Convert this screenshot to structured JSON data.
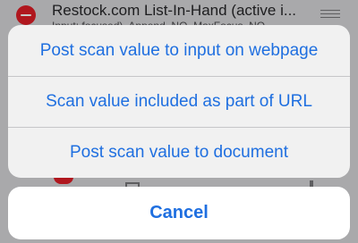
{
  "background_row": {
    "title": "Restock.com List-In-Hand (active i...",
    "subtitle": "Input: focused), Append, NO, MaxFocus, NO",
    "icon": "minus-circle-icon"
  },
  "action_sheet": {
    "options": [
      {
        "label": "Post scan value to input on webpage"
      },
      {
        "label": "Scan value included as part of URL"
      },
      {
        "label": "Post scan value to document"
      }
    ],
    "cancel_label": "Cancel"
  },
  "colors": {
    "accent": "#1f6fe0",
    "delete_red": "#b0171e",
    "sheet_bg": "#f1f1f1",
    "overlay_bg": "#a9a9ab"
  }
}
